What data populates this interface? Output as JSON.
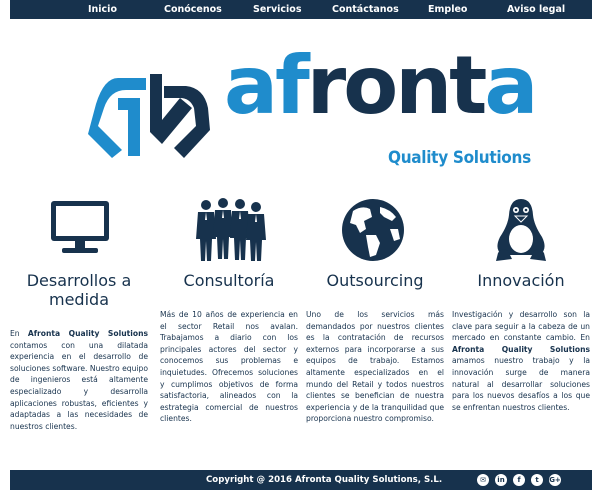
{
  "nav": {
    "items": [
      {
        "label": "Inicio"
      },
      {
        "label": "Conócenos"
      },
      {
        "label": "Servicios"
      },
      {
        "label": "Contáctanos"
      },
      {
        "label": "Empleo"
      },
      {
        "label": "Aviso legal"
      }
    ]
  },
  "logo": {
    "word_dark": "af",
    "word_light_1": "r",
    "word_dark_2": "ont",
    "word_light_2": "a",
    "subtitle": "Quality Solutions"
  },
  "columns": [
    {
      "icon": "monitor-icon",
      "title_line1": "Desarrollos a",
      "title_line2": "medida",
      "text_pre": "En ",
      "text_bold": "Afronta Quality Solutions",
      "text_post": " contamos con una dilatada experiencia en el desarrollo de soluciones software. Nuestro equipo de ingenieros está altamente especializado y desarrolla aplicaciones robustas, eficientes y adaptadas a las necesidades de nuestros clientes."
    },
    {
      "icon": "business-team-icon",
      "title_line1": "Consultoría",
      "text": "Más de 10 años de experiencia en el sector Retail nos avalan. Trabajamos a diario con los principales actores del sector y conocemos sus problemas e inquietudes. Ofrecemos soluciones y cumplimos objetivos de forma satisfactoria, alineados con la estrategia comercial de nuestros clientes."
    },
    {
      "icon": "globe-icon",
      "title_line1": "Outsourcing",
      "text": "Uno de los servicios más demandados por nuestros clientes es la contratación de recursos externos para incorporarse a sus equipos de trabajo. Estamos altamente especializados en el mundo del Retail y todos nuestros clientes se benefician de nuestra experiencia y de la tranquilidad que proporciona nuestro compromiso."
    },
    {
      "icon": "linux-penguin-icon",
      "title_line1": "Innovación",
      "text_pre": "Investigación y desarrollo son la clave para seguir a la cabeza de un mercado en constante cambio. En ",
      "text_bold": "Afronta Quality Solutions",
      "text_post": " amamos nuestro trabajo y la innovación surge de manera natural al desarrollar soluciones para los nuevos desafíos a los que se enfrentan nuestros clientes."
    }
  ],
  "footer": {
    "copyright": "Copyright @ 2016 Afronta Quality Solutions, S.L.",
    "social": [
      {
        "icon": "email-icon",
        "glyph": "✉"
      },
      {
        "icon": "linkedin-icon",
        "glyph": "in"
      },
      {
        "icon": "facebook-icon",
        "glyph": "f"
      },
      {
        "icon": "twitter-icon",
        "glyph": "t"
      },
      {
        "icon": "google-plus-icon",
        "glyph": "G+"
      }
    ]
  },
  "colors": {
    "navy": "#17324d",
    "blue": "#1f8ccc"
  }
}
